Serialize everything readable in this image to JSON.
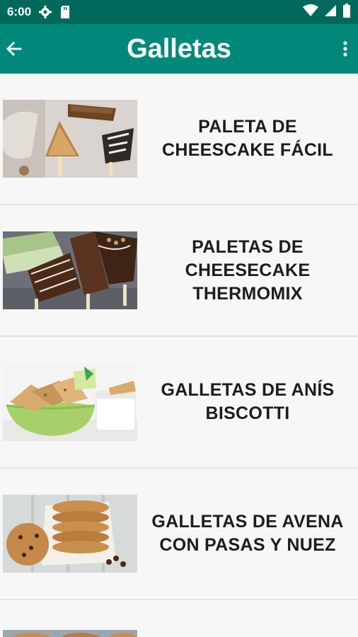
{
  "status_bar": {
    "time": "6:00",
    "icons_left": [
      "gear-icon",
      "sd-card-icon"
    ],
    "icons_right": [
      "wifi-icon",
      "signal-icon",
      "battery-icon"
    ]
  },
  "app_bar": {
    "title": "Galletas",
    "back_icon": "arrow-left-icon",
    "menu_icon": "more-vertical-icon",
    "color": "#00897b",
    "status_color": "#00695c"
  },
  "recipes": [
    {
      "title": "PALETA DE CHEESCAKE FÁCIL",
      "image": "cheesecake-pops-photo"
    },
    {
      "title": "PALETAS DE CHEESECAKE THERMOMIX",
      "image": "chocolate-cheesecake-pops-photo"
    },
    {
      "title": "GALLETAS DE ANÍS BISCOTTI",
      "image": "biscotti-bowl-photo"
    },
    {
      "title": "GALLETAS DE AVENA CON PASAS Y NUEZ",
      "image": "oatmeal-cookies-stack-photo"
    },
    {
      "title": "",
      "image": "cookies-photo"
    }
  ]
}
